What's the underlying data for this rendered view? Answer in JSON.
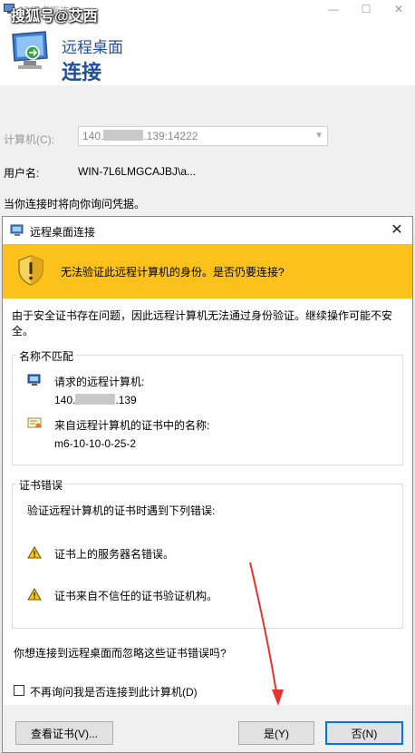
{
  "watermark": "搜狐号@艾西",
  "background_window": {
    "title": "远程桌面连接",
    "header_line1": "远程桌面",
    "header_line2": "连接",
    "computer_label": "计算机(C):",
    "computer_value_prefix": "140.",
    "computer_value_suffix": ".139:14222",
    "username_label": "用户名:",
    "username_value": "WIN-7L6LMGCAJBJ\\a...",
    "credentials_note": "当你连接时将向你询问凭据。",
    "caption_minimize": "—",
    "caption_maximize": "☐",
    "caption_close": "✕"
  },
  "dialog": {
    "title": "远程桌面连接",
    "close_glyph": "✕",
    "warning_headline": "无法验证此远程计算机的身份。是否仍要连接?",
    "intro": "由于安全证书存在问题，因此远程计算机无法通过身份验证。继续操作可能不安全。",
    "name_mismatch": {
      "legend": "名称不匹配",
      "requested_label": "请求的远程计算机:",
      "requested_prefix": "140.",
      "requested_suffix": ".139",
      "cert_name_label": "来自远程计算机的证书中的名称:",
      "cert_name_value": "m6-10-10-0-25-2"
    },
    "cert_errors": {
      "legend": "证书错误",
      "description": "验证远程计算机的证书时遇到下列错误:",
      "errors": [
        "证书上的服务器名错误。",
        "证书来自不信任的证书验证机构。"
      ]
    },
    "question": "你想连接到远程桌面而忽略这些证书错误吗?",
    "dont_ask_label": "不再询问我是否连接到此计算机(D)",
    "dont_ask_checked": false,
    "buttons": {
      "view_cert": "查看证书(V)...",
      "yes": "是(Y)",
      "no": "否(N)"
    }
  },
  "colors": {
    "warning_banner": "#fcc21b",
    "header_blue": "#1f4f9f",
    "annotation_arrow": "#e8322d"
  }
}
